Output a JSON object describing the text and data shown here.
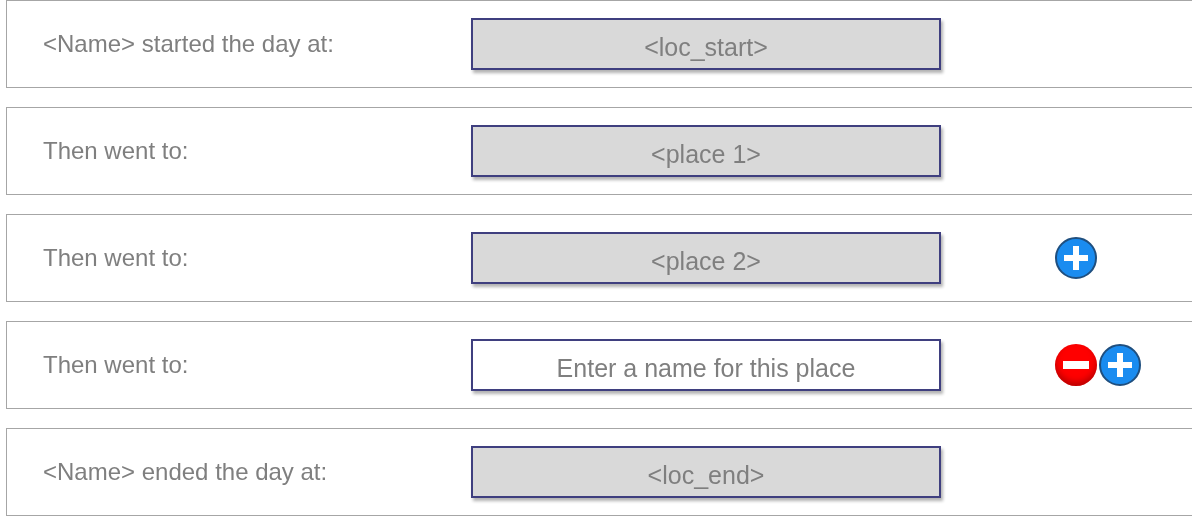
{
  "rows": [
    {
      "label": "<Name> started the day at:",
      "field": {
        "value": "<loc_start>"
      },
      "removable": false,
      "addable": false
    },
    {
      "label": "Then went to:",
      "field": {
        "value": "<place 1>"
      },
      "removable": false,
      "addable": false
    },
    {
      "label": "Then went to:",
      "field": {
        "value": "<place 2>"
      },
      "removable": false,
      "addable": true
    },
    {
      "label": "Then went to:",
      "field": {
        "placeholder": "Enter a name for this place"
      },
      "removable": true,
      "addable": true
    },
    {
      "label": "<Name> ended the day at:",
      "field": {
        "value": "<loc_end>"
      },
      "removable": false,
      "addable": false
    }
  ]
}
